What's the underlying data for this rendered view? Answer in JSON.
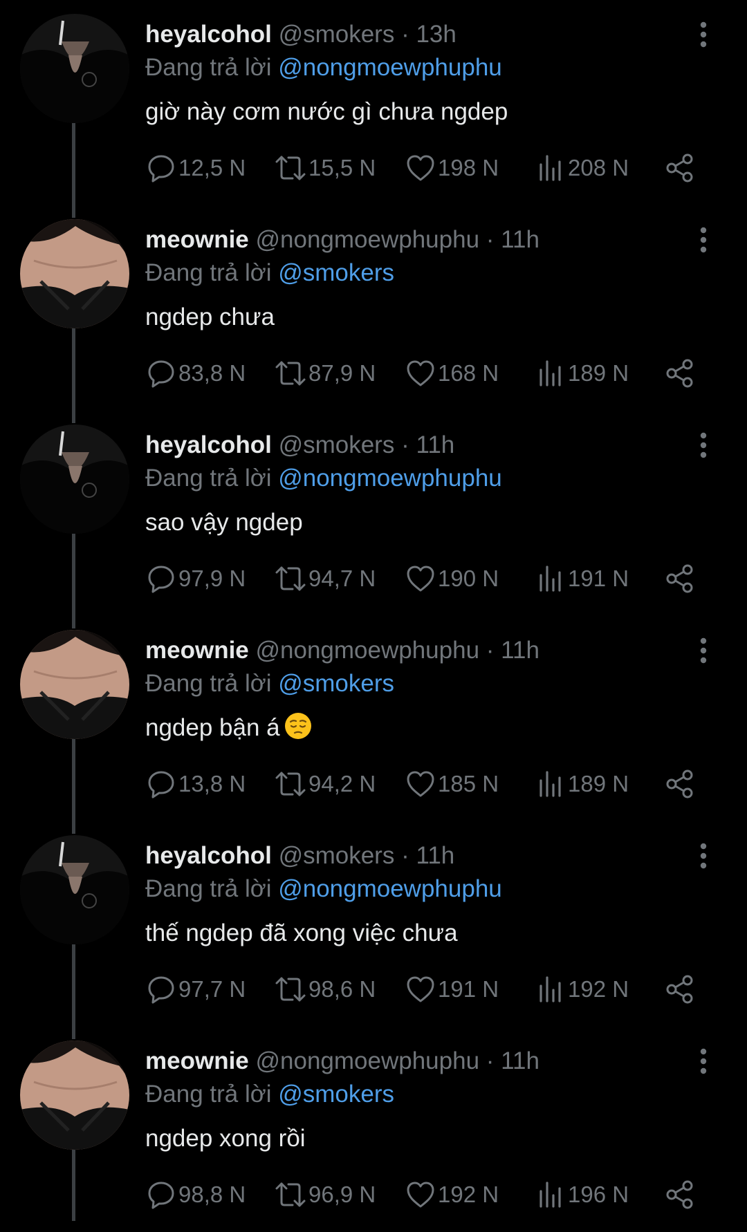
{
  "reply_prefix": "Đang trả lời",
  "tweets": [
    {
      "name": "heyalcohol",
      "handle": "@smokers",
      "dot": "·",
      "time": "13h",
      "reply_to": "@nongmoewphuphu",
      "text": "giờ này cơm nước gì chưa ngdep",
      "replies": "12,5 N",
      "retweets": "15,5 N",
      "likes": "198 N",
      "views": "208 N"
    },
    {
      "name": "meownie",
      "handle": "@nongmoewphuphu",
      "dot": "·",
      "time": "11h",
      "reply_to": "@smokers",
      "text": "ngdep chưa",
      "replies": "83,8 N",
      "retweets": "87,9 N",
      "likes": "168 N",
      "views": "189 N"
    },
    {
      "name": "heyalcohol",
      "handle": "@smokers",
      "dot": "·",
      "time": "11h",
      "reply_to": "@nongmoewphuphu",
      "text": "sao vậy ngdep",
      "replies": "97,9 N",
      "retweets": "94,7 N",
      "likes": "190 N",
      "views": "191 N"
    },
    {
      "name": "meownie",
      "handle": "@nongmoewphuphu",
      "dot": "·",
      "time": "11h",
      "reply_to": "@smokers",
      "text": "ngdep bận á",
      "emoji": "pensive-face-emoji",
      "replies": "13,8 N",
      "retweets": "94,2 N",
      "likes": "185 N",
      "views": "189 N"
    },
    {
      "name": "heyalcohol",
      "handle": "@smokers",
      "dot": "·",
      "time": "11h",
      "reply_to": "@nongmoewphuphu",
      "text": "thế ngdep đã xong việc chưa",
      "replies": "97,7 N",
      "retweets": "98,6 N",
      "likes": "191 N",
      "views": "192 N"
    },
    {
      "name": "meownie",
      "handle": "@nongmoewphuphu",
      "dot": "·",
      "time": "11h",
      "reply_to": "@smokers",
      "text": "ngdep xong rồi",
      "replies": "98,8 N",
      "retweets": "96,9 N",
      "likes": "192 N",
      "views": "196 N"
    }
  ],
  "icons": {
    "reply": "comment-bubble-icon",
    "retweet": "retweet-icon",
    "like": "heart-icon",
    "views": "views-bar-chart-icon",
    "share": "share-icon",
    "more": "vertical-ellipsis-icon"
  },
  "colors": {
    "background": "#000000",
    "primary_text": "#e7e9ea",
    "secondary_text": "#71767b",
    "link": "#4f9ee8",
    "thread_line": "#3b3f43"
  }
}
